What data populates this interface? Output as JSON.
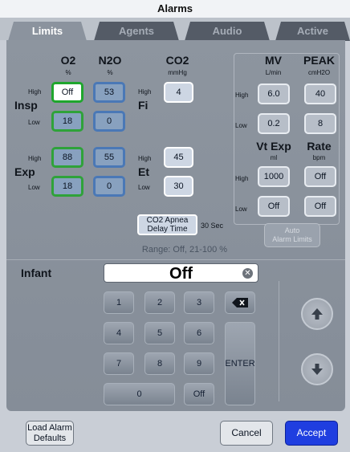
{
  "title": "Alarms",
  "tabs": [
    "Limits",
    "Agents",
    "Audio",
    "Active"
  ],
  "o2": {
    "label": "O2",
    "unit": "%",
    "insp_high": "Off",
    "insp_low": "18",
    "exp_high": "88",
    "exp_low": "18"
  },
  "n2o": {
    "label": "N2O",
    "unit": "%",
    "insp_high": "53",
    "insp_low": "0",
    "exp_high": "55",
    "exp_low": "0"
  },
  "co2": {
    "label": "CO2",
    "unit": "mmHg",
    "fi_high": "4",
    "et_high": "45",
    "et_low": "30"
  },
  "rows": {
    "insp": "Insp",
    "exp": "Exp",
    "fi": "Fi",
    "et": "Et",
    "high": "High",
    "low": "Low"
  },
  "mv": {
    "label": "MV",
    "unit": "L/min",
    "high": "6.0",
    "low": "0.2"
  },
  "peak": {
    "label": "PEAK",
    "unit": "cmH2O",
    "high": "40",
    "low": "8"
  },
  "vtexp": {
    "label": "Vt Exp",
    "unit": "ml",
    "high": "1000",
    "low": "Off"
  },
  "rate": {
    "label": "Rate",
    "unit": "bpm",
    "high": "Off",
    "low": "Off"
  },
  "apnea": {
    "line1": "CO2 Apnea",
    "line2": "Delay Time",
    "value": "30 Sec"
  },
  "auto": {
    "line1": "Auto",
    "line2": "Alarm Limits"
  },
  "range": "Range: Off, 21-100 %",
  "entry": {
    "label": "Infant",
    "value": "Off"
  },
  "keys": {
    "k1": "1",
    "k2": "2",
    "k3": "3",
    "k4": "4",
    "k5": "5",
    "k6": "6",
    "k7": "7",
    "k8": "8",
    "k9": "9",
    "k0": "0",
    "off": "Off",
    "enter": "ENTER"
  },
  "bottom": {
    "load_line1": "Load Alarm",
    "load_line2": "Defaults",
    "cancel": "Cancel",
    "accept": "Accept"
  },
  "colors": {
    "accept": "#1f3ee0",
    "active_border": "#1fa62d",
    "o2_border": "#2fa23a",
    "n2o_border": "#4a78b6"
  }
}
